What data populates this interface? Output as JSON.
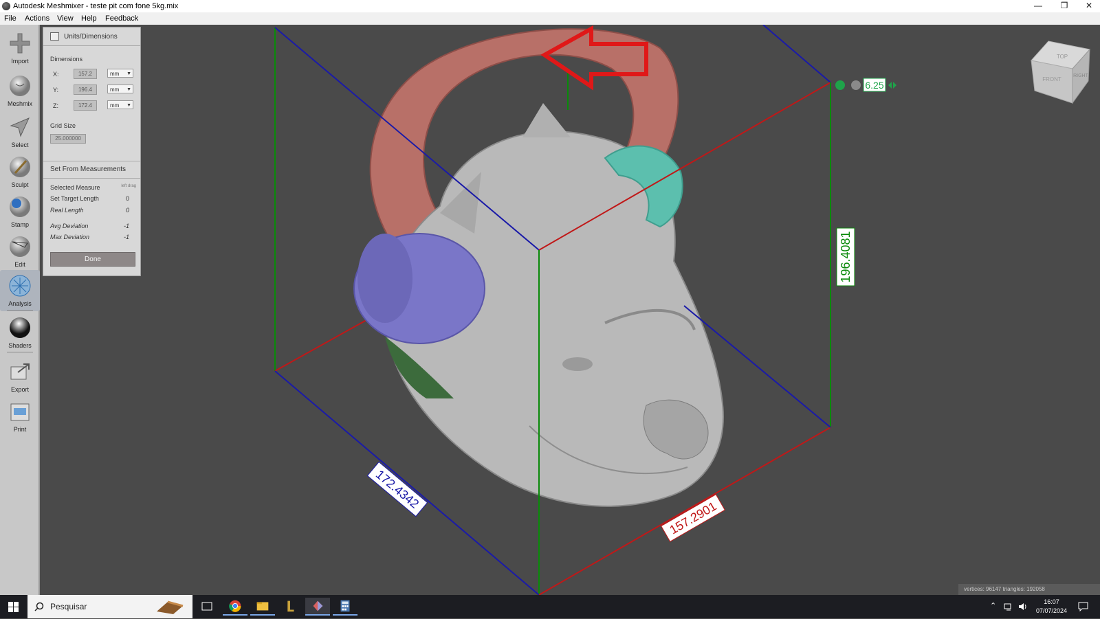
{
  "window": {
    "title": "Autodesk Meshmixer - teste pit com fone 5kg.mix",
    "minimize": "—",
    "maximize": "❐",
    "close": "✕"
  },
  "menu": [
    "File",
    "Actions",
    "View",
    "Help",
    "Feedback"
  ],
  "tools": [
    {
      "label": "Import",
      "icon": "import-icon"
    },
    {
      "label": "Meshmix",
      "icon": "meshmix-icon"
    },
    {
      "label": "Select",
      "icon": "select-icon"
    },
    {
      "label": "Sculpt",
      "icon": "sculpt-icon"
    },
    {
      "label": "Stamp",
      "icon": "stamp-icon"
    },
    {
      "label": "Edit",
      "icon": "edit-icon"
    },
    {
      "label": "Analysis",
      "icon": "analysis-icon",
      "active": true
    },
    {
      "label": "Shaders",
      "icon": "shaders-icon"
    },
    {
      "label": "Export",
      "icon": "export-icon"
    },
    {
      "label": "Print",
      "icon": "print-icon"
    }
  ],
  "panel": {
    "title": "Units/Dimensions",
    "dimensions_label": "Dimensions",
    "dims": [
      {
        "axis": "X:",
        "value": "157.2",
        "unit": "mm"
      },
      {
        "axis": "Y:",
        "value": "196.4",
        "unit": "mm"
      },
      {
        "axis": "Z:",
        "value": "172.4",
        "unit": "mm"
      }
    ],
    "grid_size_label": "Grid Size",
    "grid_size_value": "25.000000",
    "set_from_label": "Set From Measurements",
    "selected_measure_label": "Selected Measure",
    "selected_measure_value": "left drag",
    "set_target_length_label": "Set Target Length",
    "set_target_length_value": "0",
    "real_length_label": "Real Length",
    "real_length_value": "0",
    "avg_deviation_label": "Avg Deviation",
    "avg_deviation_value": "-1",
    "max_deviation_label": "Max Deviation",
    "max_deviation_value": "-1",
    "done_label": "Done"
  },
  "viewport": {
    "grid_value": "6.25",
    "dim_depth": "172.4342",
    "dim_width": "157.2901",
    "dim_height": "196.4081",
    "viewcube_faces": [
      "TOP",
      "FRONT",
      "RIGHT"
    ],
    "stats": "vertices: 96147 triangles: 192058"
  },
  "taskbar": {
    "search_placeholder": "Pesquisar",
    "time": "16:07",
    "date": "07/07/2024"
  },
  "colors": {
    "axis_red": "#c01818",
    "axis_green": "#0a8a0a",
    "axis_blue": "#1a1aa8",
    "handle": "#b87068",
    "headphone_purple": "#7a76c8",
    "headphone_teal": "#5cbfae"
  }
}
